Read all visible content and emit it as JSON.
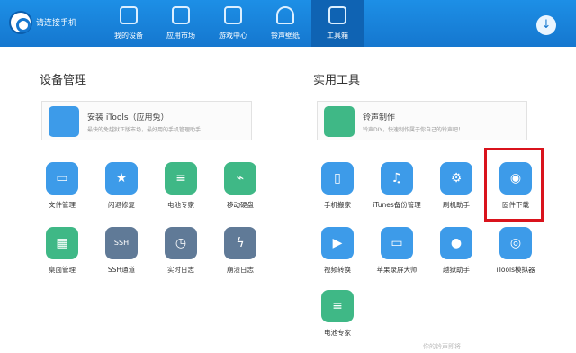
{
  "header": {
    "connect_label": "请连接手机",
    "tabs": [
      {
        "label": "我的设备",
        "icon": "phone-icon"
      },
      {
        "label": "应用市场",
        "icon": "apps-grid-icon"
      },
      {
        "label": "游戏中心",
        "icon": "gamepad-icon"
      },
      {
        "label": "铃声壁纸",
        "icon": "bell-icon"
      },
      {
        "label": "工具箱",
        "icon": "toolbox-icon",
        "active": true
      }
    ],
    "download_icon": "download-icon"
  },
  "device_mgmt": {
    "title": "设备管理",
    "banner": {
      "title": "安装 iTools（应用兔）",
      "desc": "最快的免越狱正版市场，最好用的手机管理助手"
    },
    "tools": [
      {
        "label": "文件管理",
        "icon": "folder-icon",
        "color": "#3d9be9"
      },
      {
        "label": "闪退修复",
        "icon": "star-badge-icon",
        "color": "#3d9be9"
      },
      {
        "label": "电池专家",
        "icon": "battery-doc-icon",
        "color": "#3fb886"
      },
      {
        "label": "移动硬盘",
        "icon": "usb-drive-icon",
        "color": "#3fb886"
      },
      {
        "label": "桌面管理",
        "icon": "desktop-grid-icon",
        "color": "#3fb886"
      },
      {
        "label": "SSH通道",
        "icon": "ssh-icon",
        "color": "#607a97"
      },
      {
        "label": "实时日志",
        "icon": "log-clock-icon",
        "color": "#607a97"
      },
      {
        "label": "崩溃日志",
        "icon": "crash-log-icon",
        "color": "#607a97"
      }
    ]
  },
  "utilities": {
    "title": "实用工具",
    "banner": {
      "title": "铃声制作",
      "desc": "铃声DIY，快速制作属于你自己的铃声吧！"
    },
    "tools": [
      {
        "label": "手机搬家",
        "icon": "phone-transfer-icon",
        "color": "#3d9be9"
      },
      {
        "label": "iTunes备份管理",
        "icon": "music-backup-icon",
        "color": "#3d9be9"
      },
      {
        "label": "刷机助手",
        "icon": "flash-gear-icon",
        "color": "#3d9be9"
      },
      {
        "label": "固件下载",
        "icon": "firmware-download-icon",
        "color": "#3d9be9"
      },
      {
        "label": "视频转换",
        "icon": "video-convert-icon",
        "color": "#3d9be9"
      },
      {
        "label": "苹果录屏大师",
        "icon": "screen-record-icon",
        "color": "#3d9be9"
      },
      {
        "label": "越狱助手",
        "icon": "apple-jailbreak-icon",
        "color": "#3d9be9"
      },
      {
        "label": "iTools模拟器",
        "icon": "emulator-icon",
        "color": "#3d9be9"
      },
      {
        "label": "电池专家",
        "icon": "battery-doc-icon",
        "color": "#3fb886"
      }
    ]
  },
  "highlight": "固件下载",
  "footer_text": "你的铃声即将…"
}
